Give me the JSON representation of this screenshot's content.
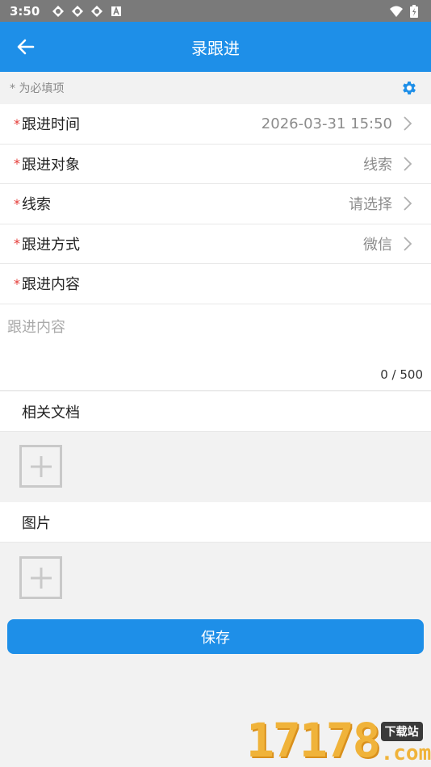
{
  "status_bar": {
    "time": "3:50",
    "left_icons": [
      "sync-icon",
      "sync-icon",
      "sync-icon",
      "app-a-icon"
    ],
    "right_icons": [
      "wifi-icon",
      "battery-icon"
    ]
  },
  "app_bar": {
    "title": "录跟进",
    "background": "#1e8fe8"
  },
  "hint": {
    "text": "* 为必填项"
  },
  "form": {
    "rows": [
      {
        "label": "跟进时间",
        "value": "2026-03-31 15:50",
        "required": true
      },
      {
        "label": "跟进对象",
        "value": "线索",
        "required": true
      },
      {
        "label": "线索",
        "value": "请选择",
        "required": true
      },
      {
        "label": "跟进方式",
        "value": "微信",
        "required": true
      },
      {
        "label": "跟进内容",
        "value": "",
        "required": true
      }
    ],
    "required_mark": "*",
    "content_placeholder": "跟进内容",
    "content_counter": "0 / 500"
  },
  "sections": {
    "documents": "相关文档",
    "images": "图片"
  },
  "save_label": "保存",
  "watermark": {
    "digits": "17178",
    "badge": "下载站",
    "suffix": ".com"
  },
  "colors": {
    "accent": "#1e8fe8",
    "required": "#e53935"
  }
}
